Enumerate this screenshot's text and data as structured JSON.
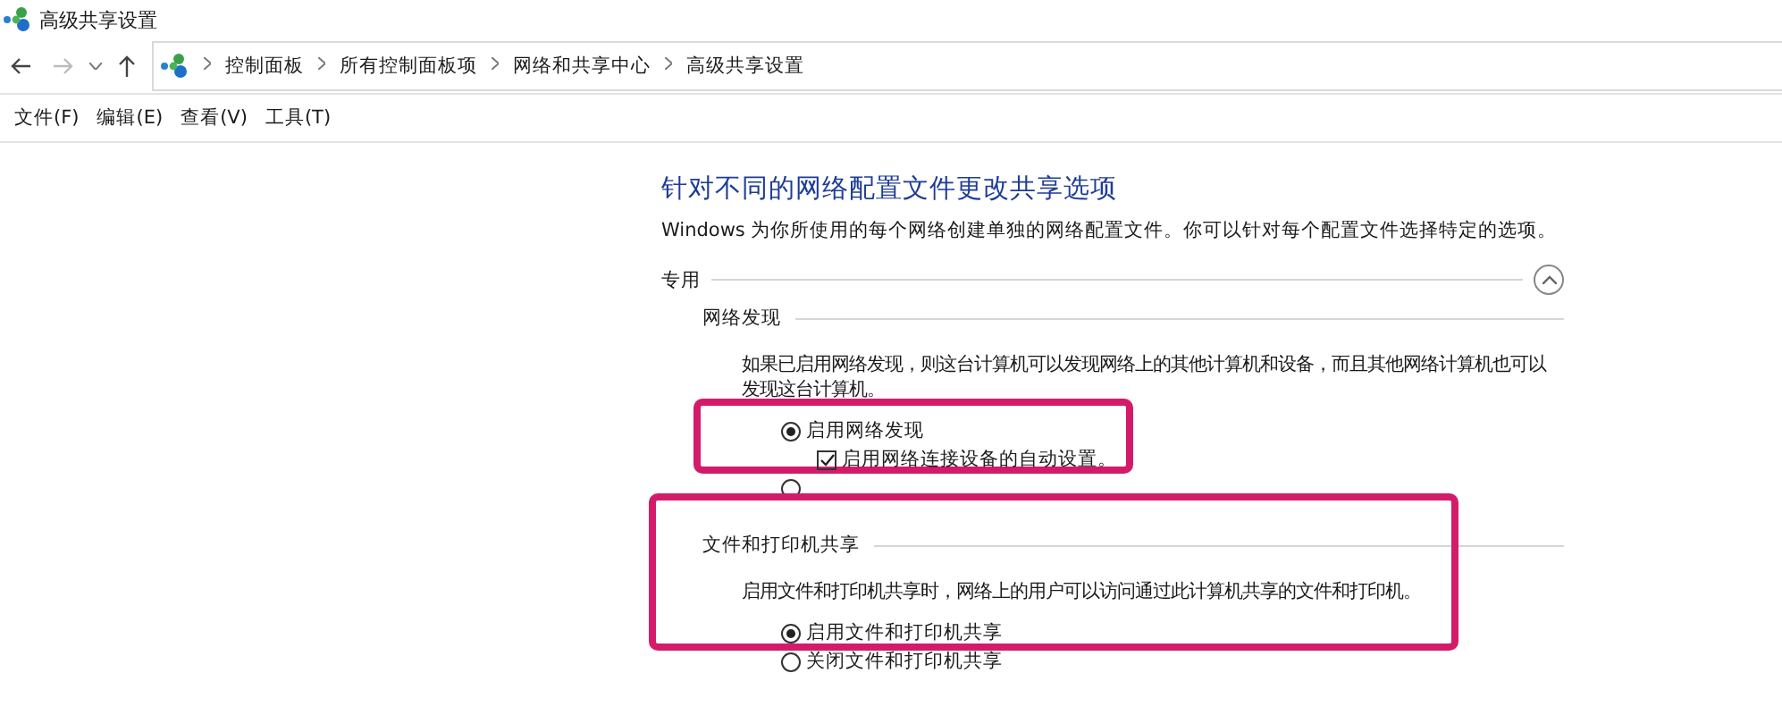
{
  "window": {
    "title": "高级共享设置"
  },
  "address_bar": {
    "breadcrumb": [
      "控制面板",
      "所有控制面板项",
      "网络和共享中心",
      "高级共享设置"
    ]
  },
  "menu": [
    "文件(F)",
    "编辑(E)",
    "查看(V)",
    "工具(T)"
  ],
  "content": {
    "heading": "针对不同的网络配置文件更改共享选项",
    "description": "Windows 为你所使用的每个网络创建单独的网络配置文件。你可以针对每个配置文件选择特定的选项。",
    "sections": [
      {
        "title": "专用",
        "expanded": true,
        "groups": [
          {
            "title": "网络发现",
            "highlight": false,
            "description": "如果已启用网络发现，则这台计算机可以发现网络上的其他计算机和设备，而且其他网络计算机也可以发现这台计算机。",
            "options": [
              {
                "kind": "radio",
                "label": "启用网络发现",
                "selected": true,
                "highlight": true,
                "children": [
                  {
                    "kind": "checkbox",
                    "label": "启用网络连接设备的自动设置。",
                    "checked": true
                  }
                ]
              },
              {
                "kind": "radio",
                "selected": false
              }
            ]
          },
          {
            "title": "文件和打印机共享",
            "highlight": true,
            "description": "启用文件和打印机共享时，网络上的用户可以访问通过此计算机共享的文件和打印机。",
            "options": [
              {
                "kind": "radio",
                "label": "启用文件和打印机共享",
                "selected": true
              },
              {
                "kind": "radio",
                "label": "关闭文件和打印机共享",
                "selected": false
              }
            ]
          }
        ]
      }
    ]
  }
}
